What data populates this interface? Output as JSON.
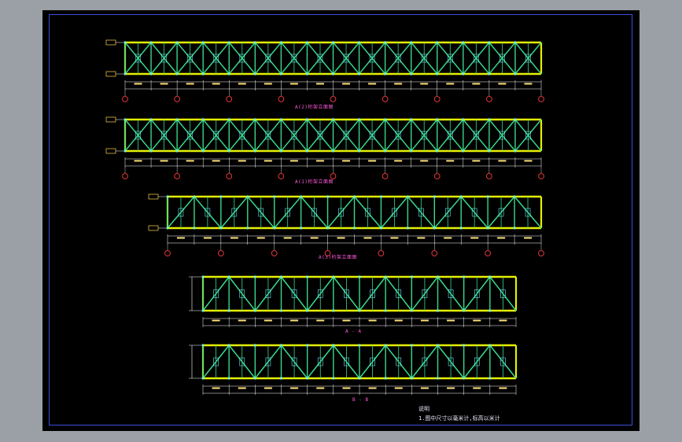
{
  "drawing": {
    "sheet_bg": "#000000",
    "frame_color": "#3a4fd8",
    "chord_color": "#e6f000",
    "web_color": "#39d98a",
    "dim_color": "#ffffff",
    "grid_bubble_color": "#ff3b3b"
  },
  "views": [
    {
      "caption": "A(2)桁架立面图"
    },
    {
      "caption": "A(1)桁架立面图"
    },
    {
      "caption": "A(3)桁架立面图"
    },
    {
      "caption": "A - A"
    },
    {
      "caption": "B - B"
    }
  ],
  "notes": {
    "heading": "说明",
    "line1": "1.图中尺寸以毫米计,标高以米计"
  }
}
